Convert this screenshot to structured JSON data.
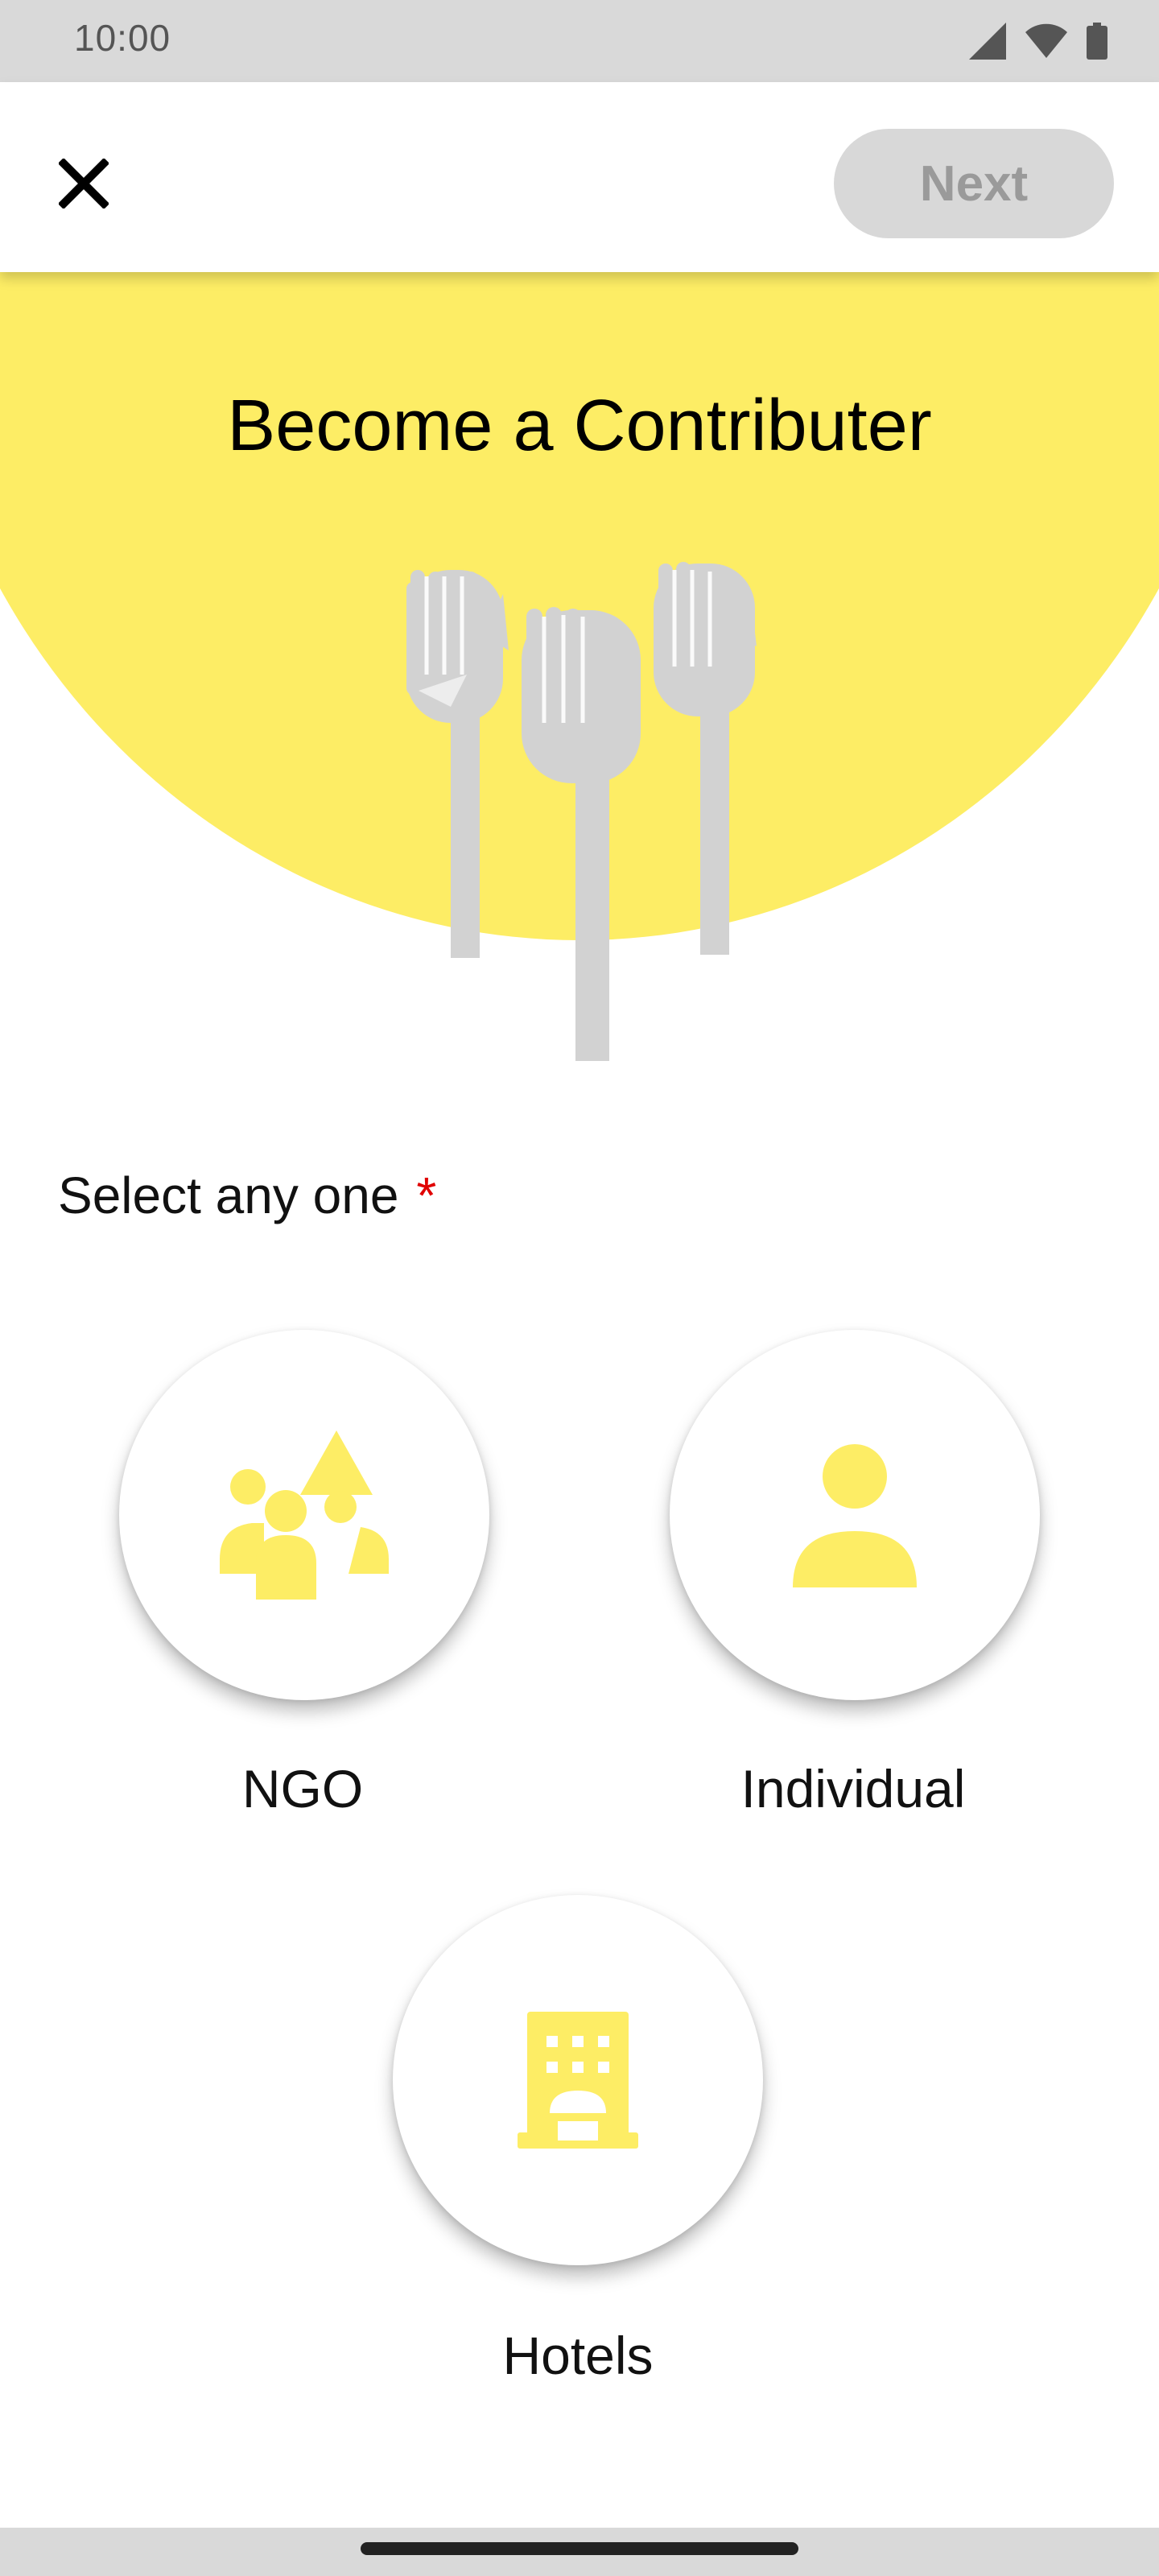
{
  "status_bar": {
    "time": "10:00",
    "icons": [
      "signal-icon",
      "wifi-icon",
      "battery-icon"
    ]
  },
  "app_bar": {
    "close_icon": "close-icon",
    "next_label": "Next"
  },
  "hero": {
    "title": "Become a Contributer",
    "illustration": "raised-hands-illustration"
  },
  "selection": {
    "label": "Select any one",
    "required_marker": "*",
    "options": [
      {
        "label": "NGO",
        "icon": "ngo-group-icon"
      },
      {
        "label": "Individual",
        "icon": "person-icon"
      },
      {
        "label": "Hotels",
        "icon": "hotel-building-icon"
      }
    ]
  },
  "colors": {
    "accent_yellow": "#FDED65",
    "hand_gray": "#D2D2D2",
    "required_red": "#E00000",
    "button_disabled_bg": "#D8D8D8",
    "button_disabled_text": "#9A9A9A"
  }
}
